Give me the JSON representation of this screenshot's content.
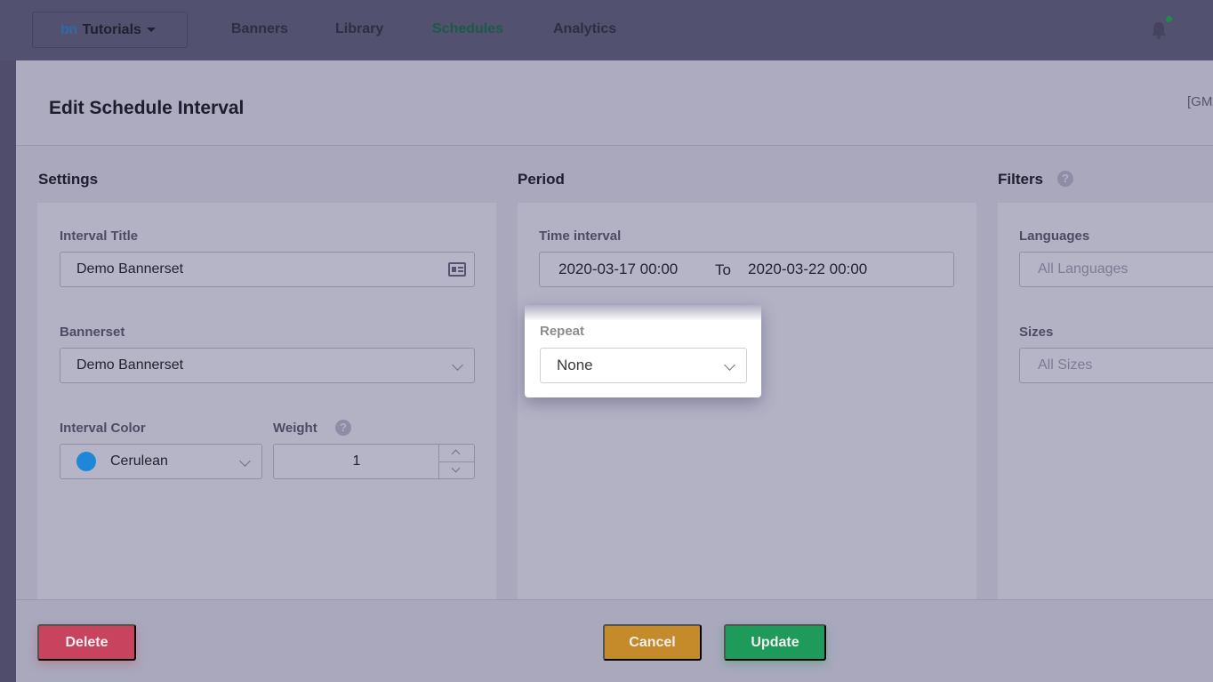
{
  "topnav": {
    "brand_logo": "bn",
    "brand_name": "Tutorials",
    "items": [
      "Banners",
      "Library",
      "Schedules",
      "Analytics"
    ],
    "active": "Schedules"
  },
  "modal": {
    "title": "Edit Schedule Interval",
    "timezone": "[GM",
    "settings": {
      "title": "Settings",
      "interval_title_label": "Interval Title",
      "interval_title_value": "Demo Bannerset",
      "bannerset_label": "Bannerset",
      "bannerset_value": "Demo Bannerset",
      "color_label": "Interval Color",
      "color_value": "Cerulean",
      "color_hex": "#1f86d8",
      "weight_label": "Weight",
      "weight_value": "1"
    },
    "period": {
      "title": "Period",
      "time_interval_label": "Time interval",
      "from": "2020-03-17 00:00",
      "to_label": "To",
      "to": "2020-03-22 00:00",
      "repeat_label": "Repeat",
      "repeat_value": "None"
    },
    "filters": {
      "title": "Filters",
      "languages_label": "Languages",
      "languages_placeholder": "All Languages",
      "sizes_label": "Sizes",
      "sizes_placeholder": "All Sizes"
    },
    "footer": {
      "delete": "Delete",
      "cancel": "Cancel",
      "update": "Update"
    }
  },
  "colors": {
    "delete": "#c8435d",
    "cancel": "#c58a2a",
    "update": "#1e9a5a"
  }
}
